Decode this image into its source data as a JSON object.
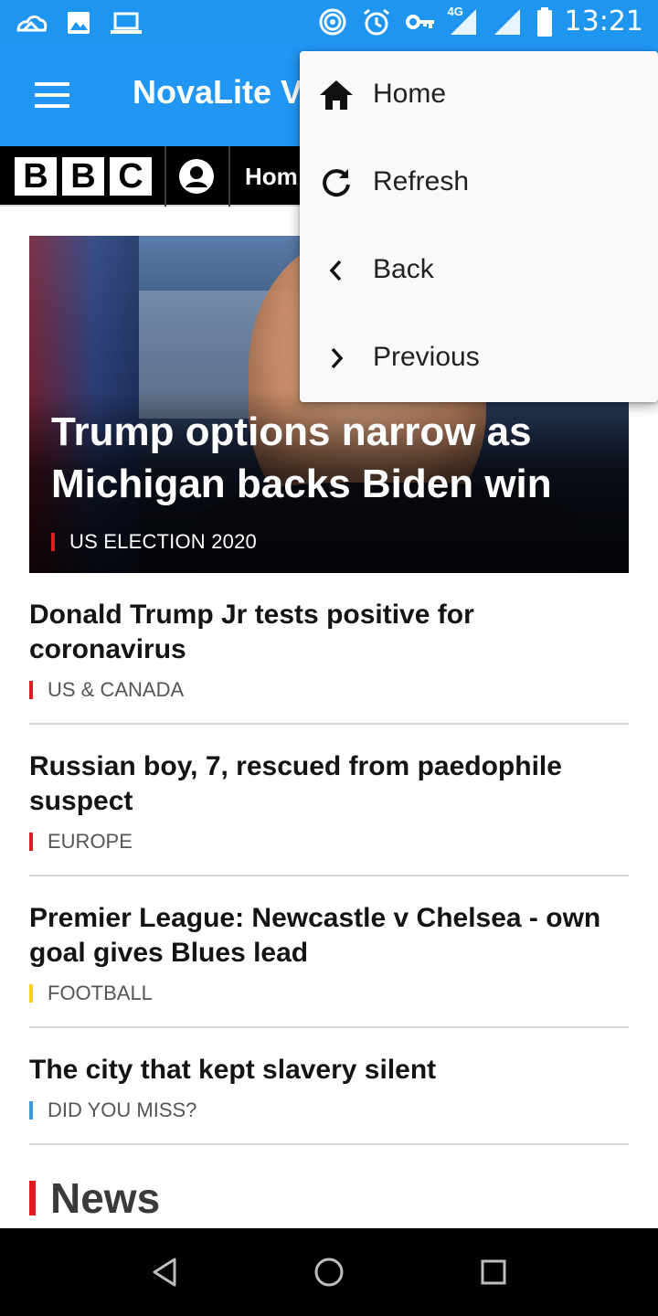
{
  "status_bar": {
    "time": "13:21",
    "network_label": "4G",
    "icons": [
      "cloud-icon",
      "image-icon",
      "laptop-icon",
      "hotspot-icon",
      "alarm-icon",
      "vpn-key-icon",
      "signal-4g-icon",
      "signal-icon",
      "battery-icon"
    ]
  },
  "app_bar": {
    "title": "NovaLite V",
    "menu_icon": "hamburger-menu-icon"
  },
  "bbc_nav": {
    "logo_letters": [
      "B",
      "B",
      "C"
    ],
    "home_label": "Hom",
    "account_icon": "account-icon"
  },
  "hero": {
    "title": "Trump options narrow as Michigan backs Biden win",
    "tag": "US ELECTION 2020",
    "tag_color": "#e11b22"
  },
  "stories": [
    {
      "title": "Donald Trump Jr tests positive for coronavirus",
      "tag": "US & CANADA",
      "tag_color": "#e11b22"
    },
    {
      "title": "Russian boy, 7, rescued from paedophile suspect",
      "tag": "EUROPE",
      "tag_color": "#e11b22"
    },
    {
      "title": "Premier League: Newcastle v Chelsea - own goal gives Blues lead",
      "tag": "FOOTBALL",
      "tag_color": "#f5d21a"
    },
    {
      "title": "The city that kept slavery silent",
      "tag": "DID YOU MISS?",
      "tag_color": "#3d9bd6"
    }
  ],
  "section": {
    "title": "News",
    "accent": "#e11b22"
  },
  "menu": {
    "items": [
      {
        "label": "Home",
        "icon": "home-icon"
      },
      {
        "label": "Refresh",
        "icon": "refresh-icon"
      },
      {
        "label": "Back",
        "icon": "chevron-left-icon"
      },
      {
        "label": "Previous",
        "icon": "chevron-right-icon"
      }
    ]
  },
  "nav_bar": {
    "buttons": [
      "back-triangle-icon",
      "home-circle-icon",
      "recents-square-icon"
    ]
  },
  "colors": {
    "status_bar": "#1e96f0",
    "app_bar": "#2196f3",
    "bbc_strip": "#000000"
  }
}
